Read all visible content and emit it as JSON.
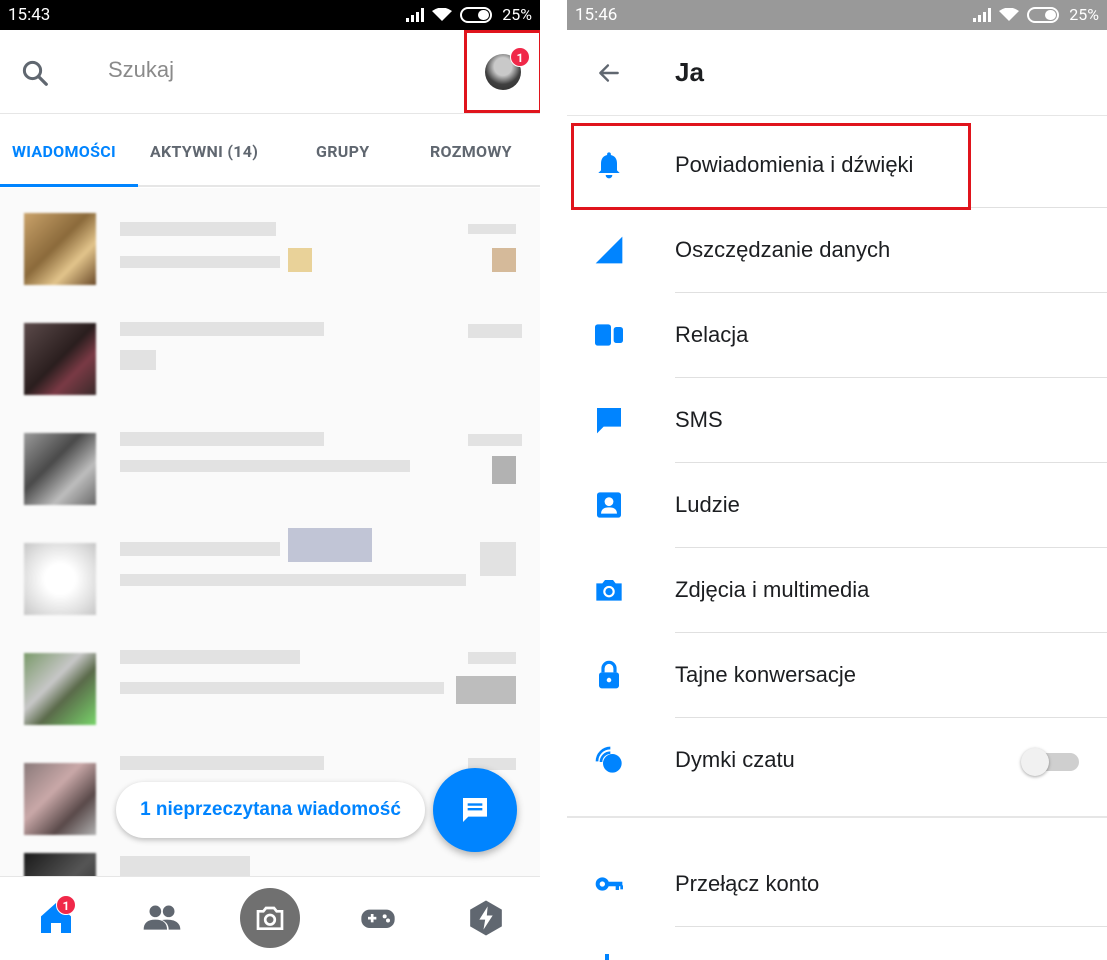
{
  "left_screen": {
    "status_bar": {
      "time": "15:43",
      "battery": "25%"
    },
    "search": {
      "placeholder": "Szukaj"
    },
    "profile": {
      "badge_count": "1"
    },
    "tabs": [
      {
        "label": "WIADOMOŚCI",
        "active": true
      },
      {
        "label": "AKTYWNI (14)",
        "active": false
      },
      {
        "label": "GRUPY",
        "active": false
      },
      {
        "label": "ROZMOWY",
        "active": false
      }
    ],
    "unread_pill": "1 nieprzeczytana wiadomość",
    "bottom_nav": {
      "home_badge": "1",
      "items": [
        "home-icon",
        "people-icon",
        "camera-icon",
        "games-icon",
        "discover-icon"
      ]
    }
  },
  "right_screen": {
    "status_bar": {
      "time": "15:46",
      "battery": "25%"
    },
    "title": "Ja",
    "menu": [
      {
        "label": "Powiadomienia i dźwięki",
        "icon": "bell-icon"
      },
      {
        "label": "Oszczędzanie danych",
        "icon": "signal-icon"
      },
      {
        "label": "Relacja",
        "icon": "story-icon"
      },
      {
        "label": "SMS",
        "icon": "sms-icon"
      },
      {
        "label": "Ludzie",
        "icon": "contact-icon"
      },
      {
        "label": "Zdjęcia i multimedia",
        "icon": "camera-icon"
      },
      {
        "label": "Tajne konwersacje",
        "icon": "lock-icon"
      },
      {
        "label": "Dymki czatu",
        "icon": "chat-heads-icon",
        "toggle": false
      }
    ],
    "secondary_menu": [
      {
        "label": "Przełącz konto",
        "icon": "key-icon"
      }
    ]
  },
  "colors": {
    "accent": "#0084ff",
    "highlight": "#e0141c",
    "badge": "#f02849"
  }
}
